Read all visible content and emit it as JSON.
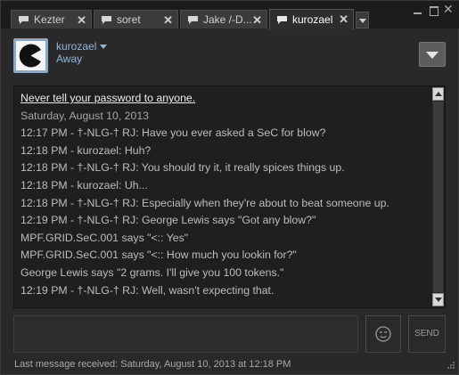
{
  "tabs": [
    {
      "label": "Kezter",
      "active": false
    },
    {
      "label": "soret",
      "active": false
    },
    {
      "label": "Jake /-D...",
      "active": false
    },
    {
      "label": "kurozael",
      "active": true
    }
  ],
  "header": {
    "username": "kurozael",
    "status": "Away"
  },
  "messages": [
    {
      "text": "Never tell your password to anyone.",
      "kind": "warn"
    },
    {
      "text": "Saturday, August 10, 2013",
      "kind": "date"
    },
    {
      "text": "12:17 PM - †-NLG-† RJ: Have you ever asked a SeC for blow?",
      "kind": "msg"
    },
    {
      "text": "12:18 PM - kurozael: Huh?",
      "kind": "msg"
    },
    {
      "text": "12:18 PM - †-NLG-† RJ: You should try it, it really spices things up.",
      "kind": "msg"
    },
    {
      "text": "12:18 PM - kurozael: Uh...",
      "kind": "msg"
    },
    {
      "text": "12:18 PM - †-NLG-† RJ: Especially when they're about to beat someone up.",
      "kind": "msg"
    },
    {
      "text": "12:19 PM - †-NLG-† RJ: George Lewis says \"Got any blow?\"",
      "kind": "msg"
    },
    {
      "text": "MPF.GRID.SeC.001 says \"<:: Yes\"",
      "kind": "msg"
    },
    {
      "text": "MPF.GRID.SeC.001 says \"<:: How much you lookin for?\"",
      "kind": "msg"
    },
    {
      "text": "George Lewis says \"2 grams. I'll give you 100 tokens.\"",
      "kind": "msg"
    },
    {
      "text": "12:19 PM - †-NLG-† RJ: Well, wasn't expecting that.",
      "kind": "msg"
    }
  ],
  "input": {
    "value": ""
  },
  "send_label": "SEND",
  "footer": "Last message received: Saturday, August 10, 2013 at 12:18 PM",
  "icons": {
    "tab": "chat-bubble-icon",
    "close": "close-icon",
    "emoji": "emoticon-icon",
    "avatar": "pacman-avatar"
  },
  "colors": {
    "background": "#292929",
    "tabbar": "#1c1c1c",
    "accent": "#8fb6d9",
    "chat_text": "#bdbdbd"
  }
}
